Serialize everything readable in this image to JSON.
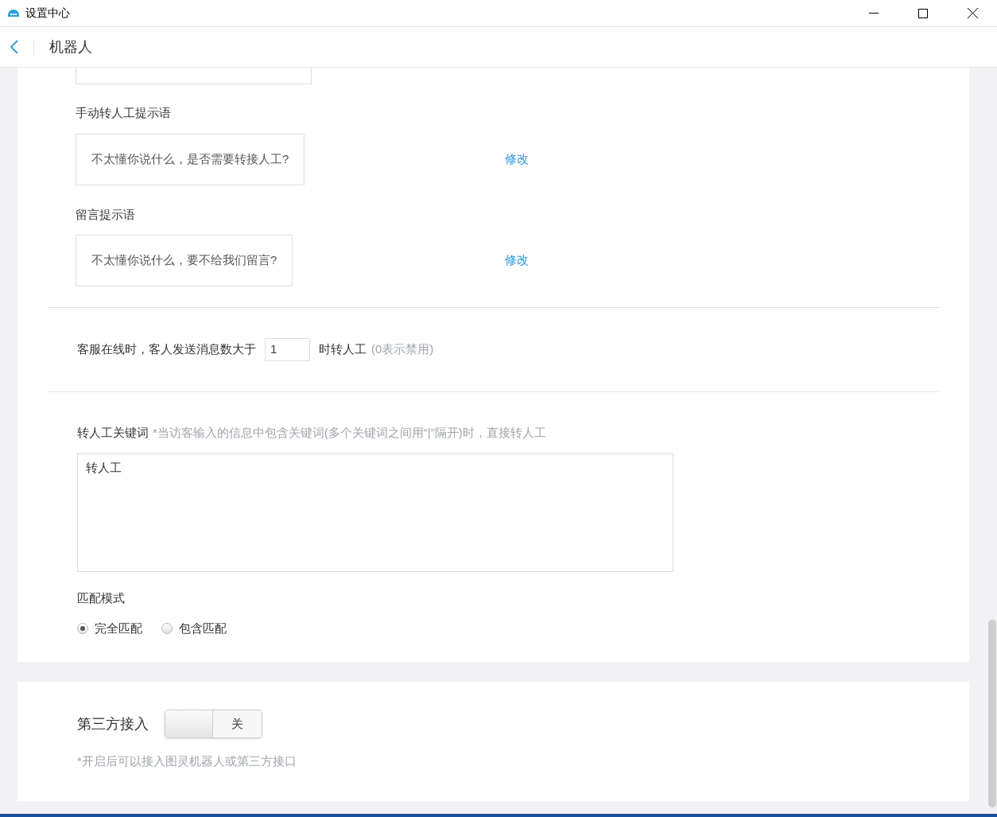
{
  "window": {
    "title": "设置中心"
  },
  "header": {
    "title": "机器人"
  },
  "prompts": [
    {
      "label": "手动转人工提示语",
      "value": "不太懂你说什么，是否需要转接人工?",
      "action": "修改"
    },
    {
      "label": "留言提示语",
      "value": "不太懂你说什么，要不给我们留言?",
      "action": "修改"
    }
  ],
  "transfer_rule": {
    "before": "客服在线时，客人发送消息数大于",
    "value": "1",
    "after": "时转人工",
    "hint": "(0表示禁用)"
  },
  "keywords": {
    "label": "转人工关键词",
    "hint": "*当访客输入的信息中包含关键词(多个关键词之间用“|”隔开)时，直接转人工",
    "value": "转人工"
  },
  "match_mode": {
    "label": "匹配模式",
    "options": [
      {
        "label": "完全匹配",
        "selected": true
      },
      {
        "label": "包含匹配",
        "selected": false
      }
    ]
  },
  "third_party": {
    "label": "第三方接入",
    "on": false,
    "toggle_label": "关",
    "note": "*开启后可以接入图灵机器人或第三方接口"
  }
}
